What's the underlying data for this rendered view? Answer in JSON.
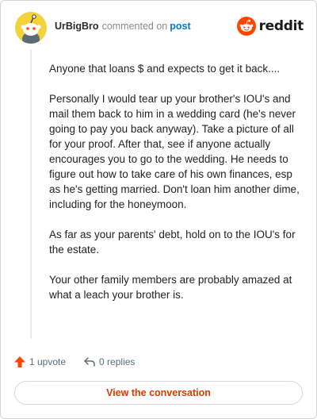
{
  "header": {
    "username": "UrBigBro",
    "action_text": "commented on",
    "post_link": "post",
    "brand_wordmark": "reddit",
    "avatar_icon": "snoo-avatar-icon",
    "brand_icon": "reddit-logo-icon"
  },
  "comment": {
    "paragraphs": [
      "Anyone that loans $ and expects to get it back....",
      "Personally I would tear up your brother's IOU's and mail them back to him in a wedding card (he's never going to pay you back anyway). Take a picture of all for your proof. After that, see if anyone actually encourages you to go to the wedding. He needs to figure out how to take care of his own finances, esp as he's getting married. Don't loan him another dime, including for the honeymoon.",
      "As far as your parents' debt, hold on to the IOU's for the estate.",
      "Your other family members are probably amazed at what a leach your brother is."
    ]
  },
  "actions": {
    "upvote_label": "1 upvote",
    "replies_label": "0 replies",
    "upvote_icon": "upvote-arrow-icon",
    "reply_icon": "reply-arrow-icon"
  },
  "cta": {
    "label": "View the conversation"
  },
  "colors": {
    "brand_orange": "#ff4500",
    "link_blue": "#0079d3",
    "cta_text": "#d93a00",
    "avatar_yellow": "#f4d23b"
  }
}
